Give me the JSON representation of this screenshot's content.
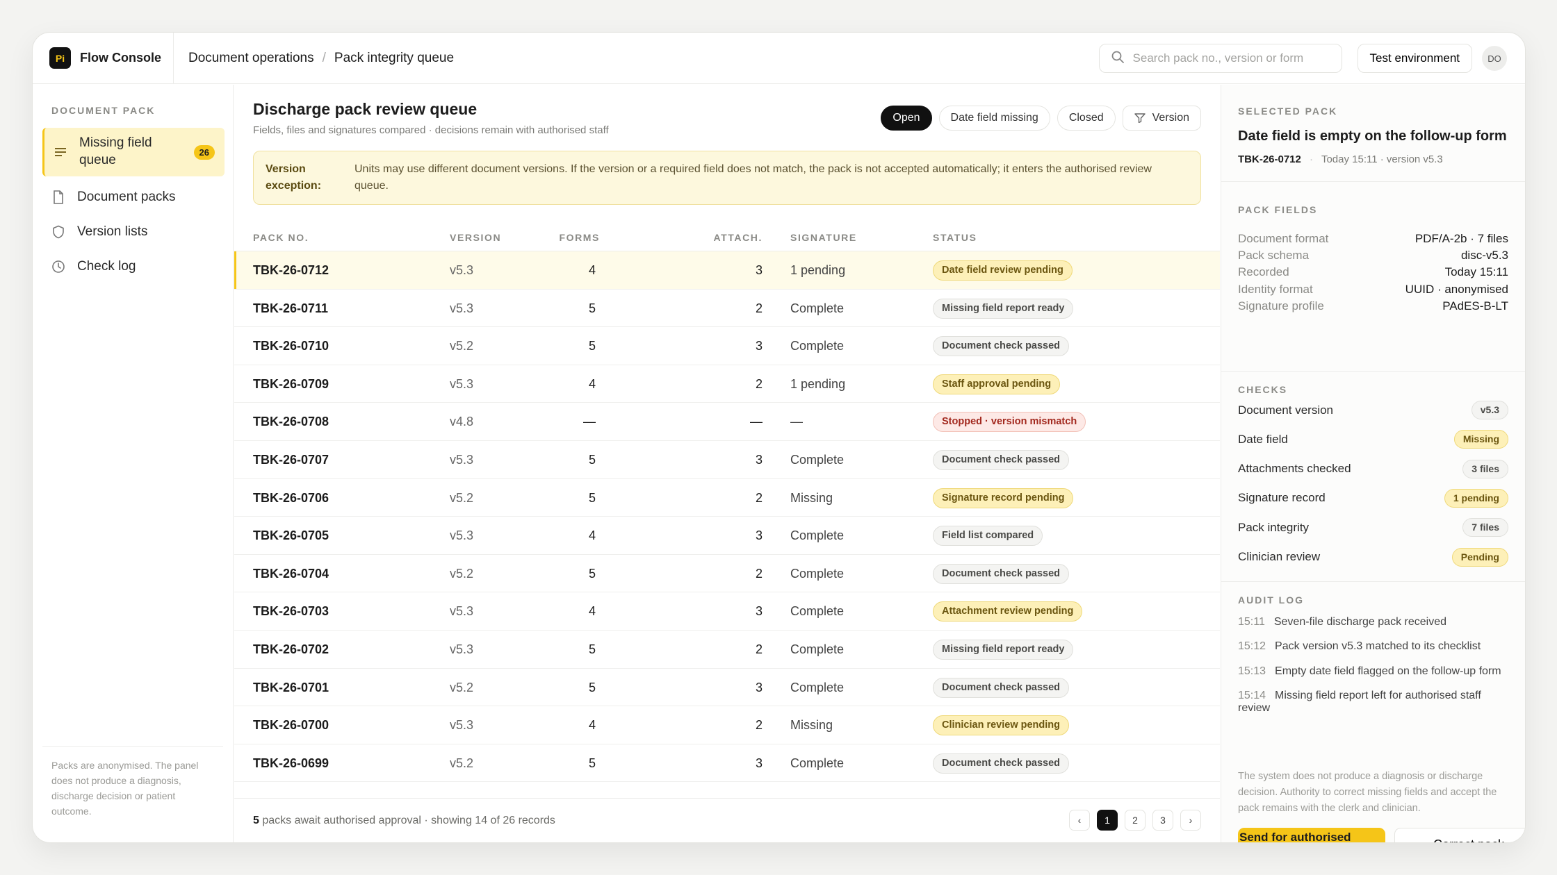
{
  "brand": {
    "logo": "Pi",
    "name": "Flow Console"
  },
  "breadcrumb": [
    "Document operations",
    "Pack integrity queue"
  ],
  "search": {
    "placeholder": "Search pack no., version or form",
    "value": ""
  },
  "env_label": "Test environment",
  "avatar": "DO",
  "sidebar": {
    "section": "DOCUMENT PACK",
    "items": [
      {
        "label": "Missing field queue",
        "icon": "list-icon",
        "count": "26"
      },
      {
        "label": "Document packs",
        "icon": "document-icon"
      },
      {
        "label": "Version lists",
        "icon": "shield-icon"
      },
      {
        "label": "Check log",
        "icon": "clock-icon"
      }
    ],
    "note": "Packs are anonymised. The panel does not produce a diagnosis, discharge decision or patient outcome."
  },
  "main": {
    "title": "Discharge pack review queue",
    "subtitle": "Fields, files and signatures compared · decisions remain with authorised staff",
    "filters": [
      "Open",
      "Date field missing",
      "Closed",
      "Version"
    ],
    "notice_title": "Version exception:",
    "notice_body": "Units may use different document versions. If the version or a required field does not match, the pack is not accepted automatically; it enters the authorised review queue.",
    "columns": [
      "PACK NO.",
      "VERSION",
      "FORMS",
      "ATTACH.",
      "SIGNATURE",
      "STATUS"
    ],
    "rows": [
      {
        "pack": "TBK-26-0712",
        "version": "v5.3",
        "forms": "4",
        "attach": "3",
        "signature": "1 pending",
        "status": "Date field review pending"
      },
      {
        "pack": "TBK-26-0711",
        "version": "v5.3",
        "forms": "5",
        "attach": "2",
        "signature": "Complete",
        "status": "Missing field report ready"
      },
      {
        "pack": "TBK-26-0710",
        "version": "v5.2",
        "forms": "5",
        "attach": "3",
        "signature": "Complete",
        "status": "Document check passed"
      },
      {
        "pack": "TBK-26-0709",
        "version": "v5.3",
        "forms": "4",
        "attach": "2",
        "signature": "1 pending",
        "status": "Staff approval pending"
      },
      {
        "pack": "TBK-26-0708",
        "version": "v4.8",
        "forms": "—",
        "attach": "—",
        "signature": "—",
        "status": "Stopped · version mismatch"
      },
      {
        "pack": "TBK-26-0707",
        "version": "v5.3",
        "forms": "5",
        "attach": "3",
        "signature": "Complete",
        "status": "Document check passed"
      },
      {
        "pack": "TBK-26-0706",
        "version": "v5.2",
        "forms": "5",
        "attach": "2",
        "signature": "Missing",
        "status": "Signature record pending"
      },
      {
        "pack": "TBK-26-0705",
        "version": "v5.3",
        "forms": "4",
        "attach": "3",
        "signature": "Complete",
        "status": "Field list compared"
      },
      {
        "pack": "TBK-26-0704",
        "version": "v5.2",
        "forms": "5",
        "attach": "2",
        "signature": "Complete",
        "status": "Document check passed"
      },
      {
        "pack": "TBK-26-0703",
        "version": "v5.3",
        "forms": "4",
        "attach": "3",
        "signature": "Complete",
        "status": "Attachment review pending"
      },
      {
        "pack": "TBK-26-0702",
        "version": "v5.3",
        "forms": "5",
        "attach": "2",
        "signature": "Complete",
        "status": "Missing field report ready"
      },
      {
        "pack": "TBK-26-0701",
        "version": "v5.2",
        "forms": "5",
        "attach": "3",
        "signature": "Complete",
        "status": "Document check passed"
      },
      {
        "pack": "TBK-26-0700",
        "version": "v5.3",
        "forms": "4",
        "attach": "2",
        "signature": "Missing",
        "status": "Clinician review pending"
      },
      {
        "pack": "TBK-26-0699",
        "version": "v5.2",
        "forms": "5",
        "attach": "3",
        "signature": "Complete",
        "status": "Document check passed"
      }
    ],
    "footer_count": "5",
    "footer_text": " packs await authorised approval · showing 14 of 26 records",
    "pages": [
      "‹",
      "1",
      "2",
      "3",
      "›"
    ]
  },
  "panel": {
    "section_selected": "SELECTED PACK",
    "title": "Date field is empty on the follow-up form",
    "pack": "TBK-26-0712",
    "meta": "Today 15:11 · version v5.3",
    "section_fields": "PACK FIELDS",
    "fields": [
      {
        "k": "Document format",
        "v": "PDF/A-2b · 7 files"
      },
      {
        "k": "Pack schema",
        "v": "disc-v5.3"
      },
      {
        "k": "Recorded",
        "v": "Today 15:11"
      },
      {
        "k": "Identity format",
        "v": "UUID · anonymised"
      },
      {
        "k": "Signature profile",
        "v": "PAdES-B-LT"
      }
    ],
    "section_checks": "CHECKS",
    "checks": [
      {
        "k": "Document version",
        "v": "v5.3",
        "tone": "neutral"
      },
      {
        "k": "Date field",
        "v": "Missing",
        "tone": "amber"
      },
      {
        "k": "Attachments checked",
        "v": "3 files",
        "tone": "neutral"
      },
      {
        "k": "Signature record",
        "v": "1 pending",
        "tone": "amber"
      },
      {
        "k": "Pack integrity",
        "v": "7 files",
        "tone": "neutral"
      },
      {
        "k": "Clinician review",
        "v": "Pending",
        "tone": "amber"
      }
    ],
    "section_audit": "AUDIT LOG",
    "audit": [
      {
        "t": "15:11",
        "msg": "Seven-file discharge pack received"
      },
      {
        "t": "15:12",
        "msg": "Pack version v5.3 matched to its checklist"
      },
      {
        "t": "15:13",
        "msg": "Empty date field flagged on the follow-up form"
      },
      {
        "t": "15:14",
        "msg": "Missing field report left for authorised staff review"
      }
    ],
    "disclaimer": "The system does not produce a diagnosis or discharge decision. Authority to correct missing fields and accept the pack remains with the clerk and clinician.",
    "primary_button": "Send for authorised review",
    "secondary_button": "Correct pack"
  },
  "colors": {
    "accent": "#f5c518",
    "amber_bg": "#fdf0b8",
    "red_text": "#a2281e"
  }
}
